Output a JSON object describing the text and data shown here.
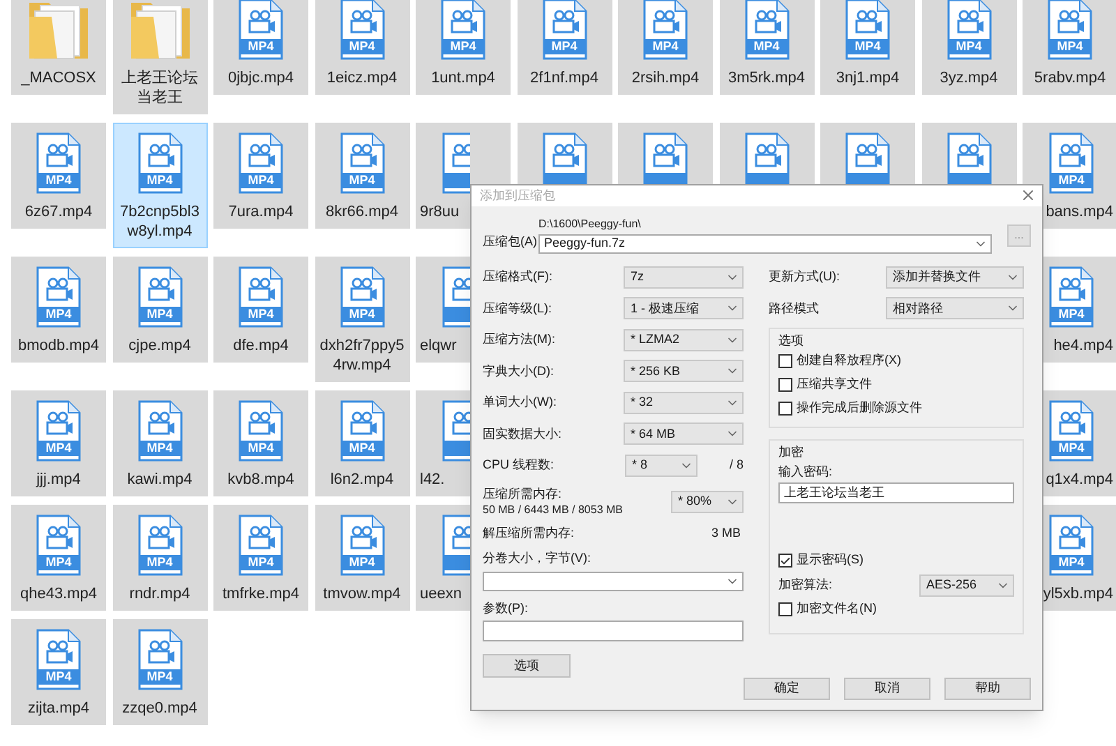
{
  "files": {
    "rows": [
      {
        "tiles": [
          {
            "kind": "folder",
            "name": "_MACOSX",
            "selected": false
          },
          {
            "kind": "folder",
            "name": "上老王论坛当老王",
            "selected": false
          },
          {
            "kind": "video",
            "name": "0jbjc.mp4",
            "badge": "MP4",
            "selected": false
          },
          {
            "kind": "video",
            "name": "1eicz.mp4",
            "badge": "MP4",
            "selected": false
          },
          {
            "kind": "video",
            "name": "1unt.mp4",
            "badge": "MP4",
            "selected": false
          },
          {
            "kind": "video",
            "name": "2f1nf.mp4",
            "badge": "MP4",
            "selected": false
          },
          {
            "kind": "video",
            "name": "2rsih.mp4",
            "badge": "MP4",
            "selected": false
          },
          {
            "kind": "video",
            "name": "3m5rk.mp4",
            "badge": "MP4",
            "selected": false
          },
          {
            "kind": "video",
            "name": "3nj1.mp4",
            "badge": "MP4",
            "selected": false
          },
          {
            "kind": "video",
            "name": "3yz.mp4",
            "badge": "MP4",
            "selected": false
          },
          {
            "kind": "video",
            "name": "5rabv.mp4",
            "badge": "MP4",
            "selected": false
          }
        ]
      },
      {
        "tiles": [
          {
            "kind": "video",
            "name": "6z67.mp4",
            "badge": "MP4",
            "selected": false
          },
          {
            "kind": "video",
            "name": "7b2cnp5bl3w8yl.mp4",
            "badge": "MP4",
            "selected": true
          },
          {
            "kind": "video",
            "name": "7ura.mp4",
            "badge": "MP4",
            "selected": false
          },
          {
            "kind": "video",
            "name": "8kr66.mp4",
            "badge": "MP4",
            "selected": false
          },
          {
            "kind": "cutright",
            "name": "9r8uu",
            "selected": false
          },
          {
            "kind": "unnamed",
            "selected": false
          },
          {
            "kind": "unnamed",
            "selected": false
          },
          {
            "kind": "unnamed",
            "selected": false
          },
          {
            "kind": "unnamed",
            "selected": false
          },
          {
            "kind": "unnamed",
            "selected": false
          }
        ],
        "edge_tile": {
          "kind": "cutleft",
          "name": "bans.mp4",
          "badge": "MP4",
          "selected": false
        }
      },
      {
        "tiles": [
          {
            "kind": "video",
            "name": "bmodb.mp4",
            "badge": "MP4",
            "selected": false
          },
          {
            "kind": "video",
            "name": "cjpe.mp4",
            "badge": "MP4",
            "selected": false
          },
          {
            "kind": "video",
            "name": "dfe.mp4",
            "badge": "MP4",
            "selected": false
          },
          {
            "kind": "video",
            "name": "dxh2fr7ppy54rw.mp4",
            "badge": "MP4",
            "selected": false
          },
          {
            "kind": "cutright",
            "name": "elqwr",
            "selected": false
          }
        ],
        "edge_tile": {
          "kind": "cutleft",
          "name": "he4.mp4",
          "badge": "MP4",
          "selected": false
        }
      },
      {
        "tiles": [
          {
            "kind": "video",
            "name": "jjj.mp4",
            "badge": "MP4",
            "selected": false
          },
          {
            "kind": "video",
            "name": "kawi.mp4",
            "badge": "MP4",
            "selected": false
          },
          {
            "kind": "video",
            "name": "kvb8.mp4",
            "badge": "MP4",
            "selected": false
          },
          {
            "kind": "video",
            "name": "l6n2.mp4",
            "badge": "MP4",
            "selected": false
          },
          {
            "kind": "cutright",
            "name": "l42.",
            "selected": false
          }
        ],
        "edge_tile": {
          "kind": "cutleft",
          "name": "q1x4.mp4",
          "badge": "MP4",
          "selected": false
        }
      },
      {
        "tiles": [
          {
            "kind": "video",
            "name": "qhe43.mp4",
            "badge": "MP4",
            "selected": false
          },
          {
            "kind": "video",
            "name": "rndr.mp4",
            "badge": "MP4",
            "selected": false
          },
          {
            "kind": "video",
            "name": "tmfrke.mp4",
            "badge": "MP4",
            "selected": false
          },
          {
            "kind": "video",
            "name": "tmvow.mp4",
            "badge": "MP4",
            "selected": false
          },
          {
            "kind": "cutright",
            "name": "ueexn",
            "selected": false
          }
        ],
        "edge_tile": {
          "kind": "cutleft",
          "name": "yl5xb.mp4",
          "badge": "MP4",
          "selected": false
        }
      },
      {
        "tiles": [
          {
            "kind": "video",
            "name": "zijta.mp4",
            "badge": "MP4",
            "selected": false
          },
          {
            "kind": "video",
            "name": "zzqe0.mp4",
            "badge": "MP4",
            "selected": false
          }
        ]
      }
    ]
  },
  "dialog": {
    "title": "添加到压缩包",
    "archive": {
      "label": "压缩包(A)",
      "path": "D:\\1600\\Peeggy-fun\\",
      "value": "Peeggy-fun.7z",
      "browse": "..."
    },
    "settings": [
      {
        "kind": "select",
        "label": "压缩格式(F):",
        "value": "7z"
      },
      {
        "kind": "select",
        "label": "压缩等级(L):",
        "value": "1 - 极速压缩"
      },
      {
        "kind": "select",
        "label": "压缩方法(M):",
        "value": "* LZMA2"
      },
      {
        "kind": "select",
        "label": "字典大小(D):",
        "value": "* 256 KB"
      },
      {
        "kind": "select",
        "label": "单词大小(W):",
        "value": "* 32"
      },
      {
        "kind": "select",
        "label": "固实数据大小:",
        "value": "* 64 MB"
      },
      {
        "kind": "threads",
        "label": "CPU 线程数:",
        "value": "* 8",
        "note": "/ 8"
      },
      {
        "kind": "memory",
        "label": "压缩所需内存:",
        "detail": "50 MB / 6443 MB / 8053 MB",
        "value": "* 80%"
      },
      {
        "kind": "info",
        "label": "解压缩所需内存:",
        "value": "3 MB"
      }
    ],
    "volume": {
      "label": "分卷大小，字节(V):"
    },
    "params": {
      "label": "参数(P):"
    },
    "options_button": "选项",
    "update": {
      "label": "更新方式(U):",
      "value": "添加并替换文件"
    },
    "path_mode": {
      "label": "路径模式",
      "value": "相对路径"
    },
    "options": {
      "title": "选项",
      "checkboxes": [
        {
          "label": "创建自释放程序(X)",
          "checked": false
        },
        {
          "label": "压缩共享文件",
          "checked": false
        },
        {
          "label": "操作完成后删除源文件",
          "checked": false
        }
      ]
    },
    "encryption": {
      "title": "加密",
      "password_label": "输入密码:",
      "password": "上老王论坛当老王",
      "show_password": {
        "label": "显示密码(S)",
        "checked": true
      },
      "method": {
        "label": "加密算法:",
        "value": "AES-256"
      },
      "encrypt_names": {
        "label": "加密文件名(N)",
        "checked": false
      }
    },
    "buttons": [
      "确定",
      "取消",
      "帮助"
    ]
  }
}
